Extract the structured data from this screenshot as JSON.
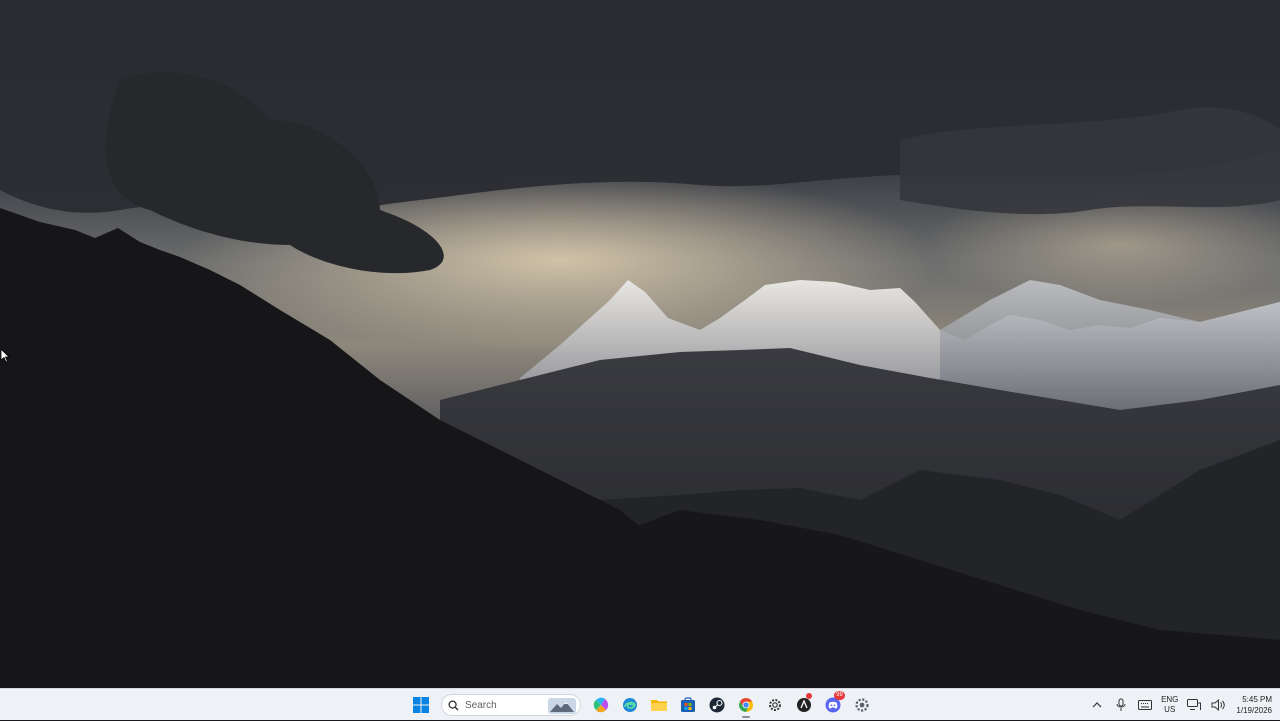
{
  "taskbar": {
    "search": {
      "placeholder": "Search"
    },
    "apps": [
      {
        "name": "start",
        "icon": "windows-logo-icon"
      },
      {
        "name": "copilot",
        "icon": "copilot-icon"
      },
      {
        "name": "edge",
        "icon": "edge-icon"
      },
      {
        "name": "file-explorer",
        "icon": "folder-icon"
      },
      {
        "name": "microsoft-store",
        "icon": "store-icon"
      },
      {
        "name": "steam",
        "icon": "steam-icon"
      },
      {
        "name": "chrome",
        "icon": "chrome-icon",
        "active": true
      },
      {
        "name": "settings-light",
        "icon": "gear-icon"
      },
      {
        "name": "app-notification",
        "icon": "app-icon"
      },
      {
        "name": "discord",
        "icon": "discord-icon",
        "badge": "99"
      },
      {
        "name": "settings",
        "icon": "settings-icon"
      }
    ]
  },
  "tray": {
    "language": {
      "code": "ENG",
      "region": "US"
    },
    "clock": {
      "time": "5:45 PM",
      "date": "1/19/2026"
    }
  },
  "colors": {
    "taskbar_bg": "#eef1f5",
    "windows_blue": "#0078d4",
    "chrome_red": "#ea4335",
    "discord_blurple": "#5865f2"
  }
}
